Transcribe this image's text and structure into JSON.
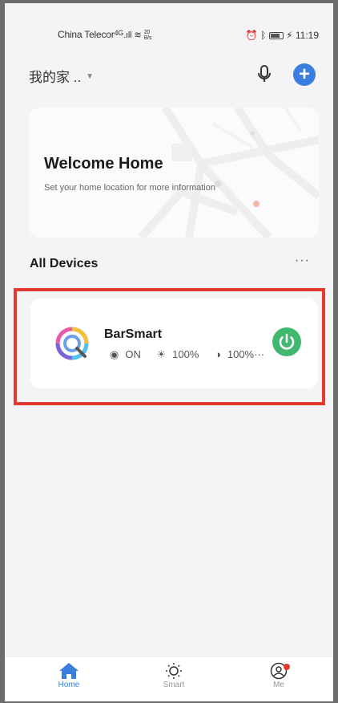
{
  "status_bar": {
    "carrier": "China Telecor",
    "signal": "4G",
    "net_speed_value": "20",
    "net_speed_unit": "B/s",
    "time": "11:19"
  },
  "header": {
    "home_name": "我的家 .."
  },
  "welcome": {
    "title": "Welcome Home",
    "subtitle": "Set your home location for more information"
  },
  "devices_section": {
    "title": "All Devices",
    "more_label": "···"
  },
  "device": {
    "name": "BarSmart",
    "status": "ON",
    "brightness": "100%",
    "level": "100%···"
  },
  "tabs": [
    {
      "label": "Home",
      "active": true
    },
    {
      "label": "Smart",
      "active": false
    },
    {
      "label": "Me",
      "active": false
    }
  ],
  "colors": {
    "accent": "#3a7fe0",
    "power_on": "#41b870",
    "highlight": "#e23b2e"
  }
}
